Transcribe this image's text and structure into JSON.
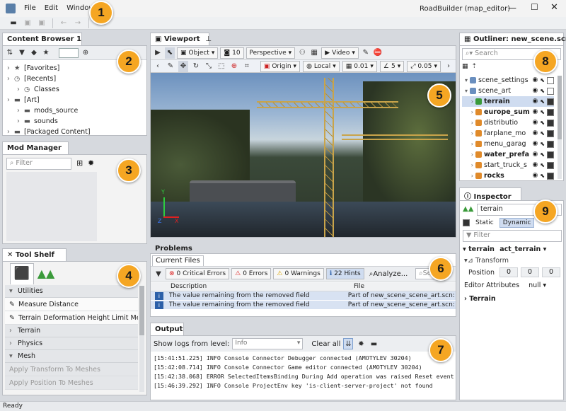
{
  "menubar": {
    "menus": [
      "File",
      "Edit",
      "Window"
    ],
    "title": "RoadBuilder (map_editor)"
  },
  "badges": [
    "1",
    "2",
    "3",
    "4",
    "5",
    "6",
    "7",
    "8",
    "9"
  ],
  "content_browser": {
    "tab": "Content Browser 1",
    "tree": [
      {
        "label": "[Favorites]",
        "indent": 0,
        "icon": "★"
      },
      {
        "label": "[Recents]",
        "indent": 0,
        "icon": "◷"
      },
      {
        "label": "Classes",
        "indent": 1,
        "icon": "◷"
      },
      {
        "label": "[Art]",
        "indent": 0,
        "icon": "▬"
      },
      {
        "label": "mods_source",
        "indent": 1,
        "icon": "▬"
      },
      {
        "label": "sounds",
        "indent": 1,
        "icon": "▬"
      },
      {
        "label": "[Packaged Content]",
        "indent": 0,
        "icon": "▬"
      }
    ]
  },
  "mod_manager": {
    "tab": "Mod Manager",
    "filter_placeholder": "Filter"
  },
  "tool_shelf": {
    "tab": "Tool Shelf",
    "sections": [
      {
        "label": "Utilities",
        "type": "header"
      },
      {
        "label": "Measure Distance",
        "type": "tool"
      },
      {
        "label": "Terrain Deformation Height Limit Measure",
        "type": "tool"
      },
      {
        "label": "Terrain",
        "type": "collapsed"
      },
      {
        "label": "Physics",
        "type": "collapsed"
      },
      {
        "label": "Mesh",
        "type": "header"
      },
      {
        "label": "Apply Transform To Meshes",
        "type": "disabled"
      },
      {
        "label": "Apply Position To Meshes",
        "type": "disabled"
      }
    ]
  },
  "viewport": {
    "tab": "Viewport",
    "toolbar": {
      "object": "Object",
      "count": "10",
      "projection": "Perspective",
      "video": "Video"
    },
    "toolbar2": {
      "origin": "Origin",
      "local": "Local",
      "grid": "0.01",
      "angle": "5",
      "scale": "0.05"
    },
    "axes": {
      "y": "Y",
      "x": "X",
      "z": "Z"
    }
  },
  "problems": {
    "tab": "Problems",
    "subtab": "Current Files",
    "filters": {
      "critical": "0 Critical Errors",
      "errors": "0 Errors",
      "warnings": "0 Warnings",
      "hints": "22 Hints",
      "analyze": "Analyze...",
      "search": "Search"
    },
    "columns": [
      "Description",
      "File"
    ],
    "rows": [
      {
        "desc": "The value remaining from the removed field",
        "file": "Part of new_scene_scene_art.scn: /"
      },
      {
        "desc": "The value remaining from the removed field",
        "file": "Part of new_scene_scene_art.scn: /"
      }
    ]
  },
  "output": {
    "tab": "Output",
    "level_label": "Show logs from level:",
    "level": "Info",
    "clear": "Clear all",
    "logs": [
      "[15:41:51.225]  INFO  Console  Connector Debugger connected (AMOTYLEV 30204)",
      "[15:42:08.714]  INFO  Console  Connector Game editor connected (AMOTYLEV 30204)",
      "[15:42:38.068]  ERROR  SelectedItemsBinding  During Add operation was raised Reset event which causes lis",
      "[15:46:39.292]  INFO  Console  ProjectEnv key 'is-client-server-project' not found"
    ]
  },
  "outliner": {
    "tab": "Outliner: new_scene.scn",
    "search_placeholder": "Search",
    "items": [
      {
        "label": "scene_settings",
        "indent": 0,
        "bold": false,
        "color": "#6a8fbf"
      },
      {
        "label": "scene_art",
        "indent": 0,
        "bold": false,
        "color": "#6a8fbf"
      },
      {
        "label": "terrain",
        "indent": 1,
        "bold": true,
        "color": "#3a9a3a"
      },
      {
        "label": "europe_sum",
        "indent": 1,
        "bold": true,
        "color": "#e08a2a"
      },
      {
        "label": "distributio",
        "indent": 1,
        "bold": false,
        "color": "#e08a2a"
      },
      {
        "label": "farplane_mo",
        "indent": 1,
        "bold": false,
        "color": "#e08a2a"
      },
      {
        "label": "menu_garag",
        "indent": 1,
        "bold": false,
        "color": "#e08a2a"
      },
      {
        "label": "water_prefa",
        "indent": 1,
        "bold": true,
        "color": "#e08a2a"
      },
      {
        "label": "start_truck_s",
        "indent": 1,
        "bold": false,
        "color": "#e08a2a"
      },
      {
        "label": "rocks",
        "indent": 1,
        "bold": true,
        "color": "#e08a2a"
      }
    ]
  },
  "inspector": {
    "tab": "Inspector",
    "name": "terrain",
    "static": "Static",
    "dynamic": "Dynamic",
    "filter_placeholder": "Filter",
    "entity": "terrain",
    "entity_type": "act_terrain",
    "transform": "Transform",
    "position_label": "Position",
    "position": [
      "0",
      "0",
      "0"
    ],
    "editor_attr": "Editor Attributes",
    "editor_attr_value": "null",
    "terrain_group": "Terrain"
  },
  "status": "Ready"
}
